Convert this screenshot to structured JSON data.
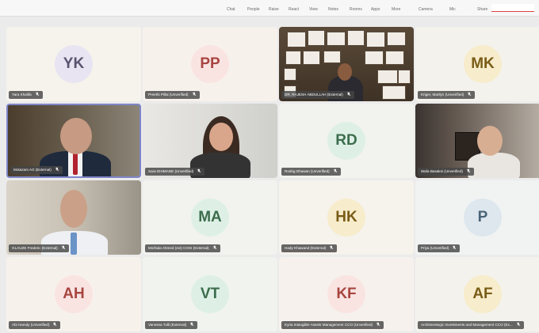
{
  "menu": [
    "Chat",
    "People",
    "Raise",
    "React",
    "View",
    "Notes",
    "Rooms",
    "Apps",
    "More",
    "Camera",
    "Mic",
    "Share"
  ],
  "participants": [
    {
      "label": "Yara Khalifa",
      "initials": "YK",
      "avatar_bg": "#e8e4f1",
      "avatar_fg": "#5a5470",
      "tile_bg": "#f6f3ec"
    },
    {
      "label": "Preethi Pillai (Unverified)",
      "initials": "PP",
      "avatar_bg": "#f9e4e2",
      "avatar_fg": "#a84540",
      "tile_bg": "#f7f1ec"
    },
    {
      "label": "DR. RAJESH ABDULLAH (External)",
      "video": "office",
      "tile_bg": "#4d3e2f"
    },
    {
      "label": "Kriger, Marilyn (Unverified)",
      "initials": "MK",
      "avatar_bg": "#f7eccb",
      "avatar_fg": "#7a5c18",
      "tile_bg": "#f3f2ec"
    },
    {
      "label": "Motazam AG (External)",
      "video": "man-suit",
      "tile_bg": "#6b6050",
      "active": true
    },
    {
      "label": "Sara DIHMANE (Unverified)",
      "video": "woman-headphones",
      "tile_bg": "#dcdcd8"
    },
    {
      "label": "Rodrig Dhawan (Unverified)",
      "initials": "RD",
      "avatar_bg": "#def0e6",
      "avatar_fg": "#3c6c4c",
      "tile_bg": "#f2f3ee"
    },
    {
      "label": "Wafa Basaksi (Unverified)",
      "video": "woman-glasses",
      "tile_bg": "#cfc7bd"
    },
    {
      "label": "GLAUZE Frederic (External)",
      "video": "man-shirt",
      "tile_bg": "#cbc4b8"
    },
    {
      "label": "Morfada Ahmed (ext) COSI (External)",
      "initials": "MA",
      "avatar_bg": "#def0e6",
      "avatar_fg": "#3c6c4c",
      "tile_bg": "#f2f3ee"
    },
    {
      "label": "Hady Khawand (External)",
      "initials": "HK",
      "avatar_bg": "#f7eccb",
      "avatar_fg": "#7a5c18",
      "tile_bg": "#f6f2ec"
    },
    {
      "label": "Priya (Unverified)",
      "initials": "P",
      "avatar_bg": "#dde7ed",
      "avatar_fg": "#4a6478",
      "tile_bg": "#f1f3f3"
    },
    {
      "label": "Abi Hamdy (Unverified)",
      "initials": "AH",
      "avatar_bg": "#f9e4e2",
      "avatar_fg": "#a84540",
      "tile_bg": "#f7f1ec"
    },
    {
      "label": "Vanessa Tulli (External)",
      "initials": "VT",
      "avatar_bg": "#def0e6",
      "avatar_fg": "#3c6c4c",
      "tile_bg": "#f1f3ee"
    },
    {
      "label": "Kyria Intangible Assets Management CCO (Unverified)",
      "initials": "KF",
      "avatar_bg": "#f9e4e2",
      "avatar_fg": "#a84540",
      "tile_bg": "#f6f1ed"
    },
    {
      "label": "Archimentegic Investments and Management CCO (Ex...",
      "initials": "AF",
      "avatar_bg": "#f7eccb",
      "avatar_fg": "#7a5c18",
      "tile_bg": "#f4f2ec"
    }
  ]
}
